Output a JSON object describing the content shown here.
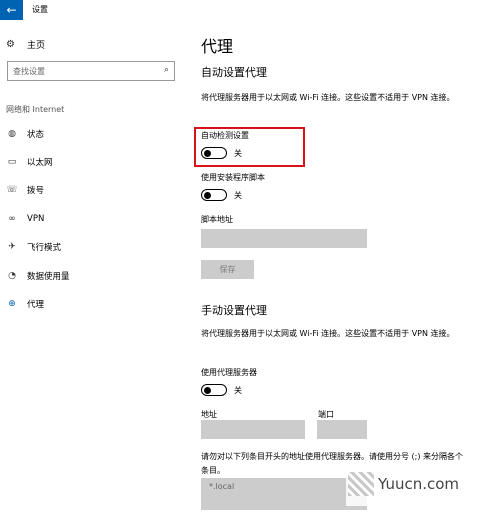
{
  "window": {
    "title": "设置"
  },
  "sidebar": {
    "home": {
      "label": "主页",
      "icon": "gear-icon"
    },
    "search": {
      "placeholder": "查找设置",
      "icon": "search-icon"
    },
    "group_label": "网络和 Internet",
    "items": [
      {
        "label": "状态",
        "icon": "globe-status-icon"
      },
      {
        "label": "以太网",
        "icon": "monitor-icon"
      },
      {
        "label": "拨号",
        "icon": "dialup-phone-icon"
      },
      {
        "label": "VPN",
        "icon": "vpn-icon"
      },
      {
        "label": "飞行模式",
        "icon": "airplane-icon"
      },
      {
        "label": "数据使用量",
        "icon": "data-usage-icon"
      },
      {
        "label": "代理",
        "icon": "globe-icon",
        "active": true
      }
    ]
  },
  "main": {
    "title": "代理",
    "auto": {
      "title": "自动设置代理",
      "description": "将代理服务器用于以太网或 Wi-Fi 连接。这些设置不适用于 VPN 连接。",
      "detect_label": "自动检测设置",
      "detect_state": "关",
      "script_label": "使用安装程序脚本",
      "script_state": "关",
      "address_label": "脚本地址",
      "save_label": "保存"
    },
    "manual": {
      "title": "手动设置代理",
      "description": "将代理服务器用于以太网或 Wi-Fi 连接。这些设置不适用于 VPN 连接。",
      "use_proxy_label": "使用代理服务器",
      "use_proxy_state": "关",
      "address_label": "地址",
      "port_label": "端口",
      "exceptions_text": "请勿对以下列条目开头的地址使用代理服务器。请使用分号 (;) 来分隔各个条目。",
      "exceptions_value": "*.local"
    }
  },
  "watermark": {
    "text": "Yuucn.com"
  },
  "colors": {
    "accent": "#0063b1",
    "highlight": "#d8141b",
    "field": "#cccccc"
  }
}
